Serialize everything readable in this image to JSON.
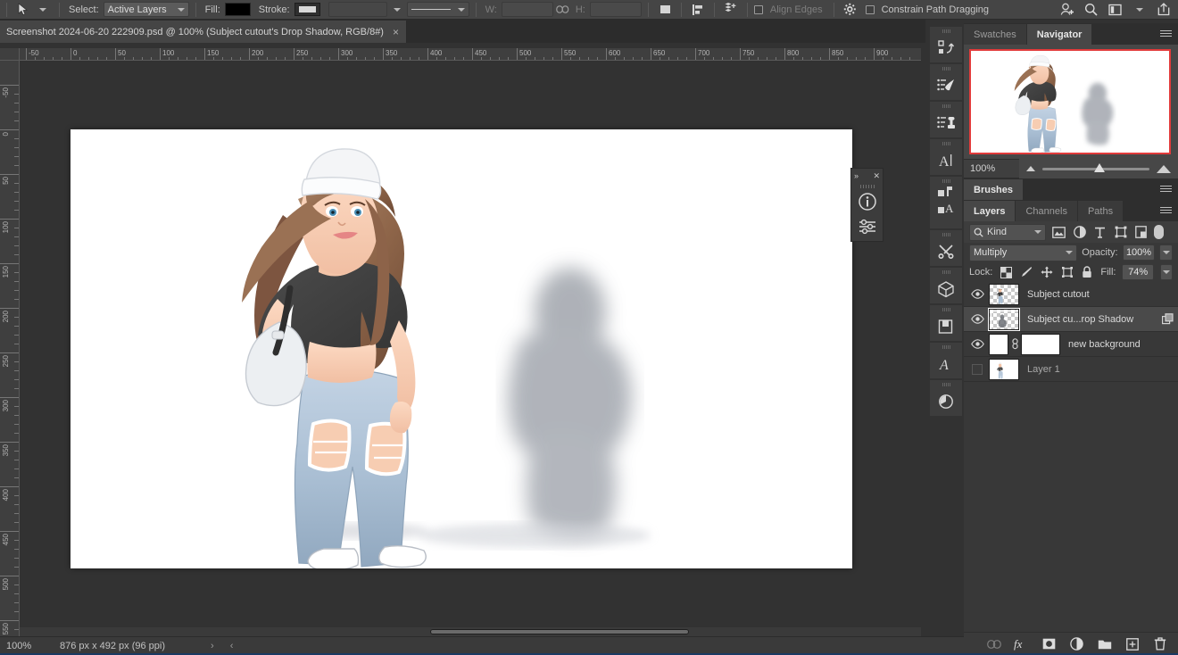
{
  "options_bar": {
    "tool_icon": "move-tool-icon",
    "select_label": "Select:",
    "select_value": "Active Layers",
    "fill_label": "Fill:",
    "fill_color": "#000000",
    "stroke_label": "Stroke:",
    "stroke_preview": "#d8d8d8",
    "width_label": "W:",
    "width_value": "",
    "link_icon": "link-icon",
    "height_label": "H:",
    "height_value": "",
    "align_edges_label": "Align Edges",
    "align_edges_checked": false,
    "constrain_label": "Constrain Path Dragging",
    "constrain_checked": false,
    "right_icons": [
      "user-add-icon",
      "search-icon",
      "workspace-icon",
      "chevron-down-icon",
      "share-icon"
    ]
  },
  "document": {
    "tab_title": "Screenshot 2024-06-20 222909.psd @ 100% (Subject cutout's Drop Shadow, RGB/8#)",
    "close_glyph": "×"
  },
  "rulers": {
    "horizontal_ticks": [
      "-50",
      "0",
      "50",
      "100",
      "150",
      "200",
      "250",
      "300",
      "350",
      "400",
      "450",
      "500",
      "550",
      "600",
      "650",
      "700",
      "750",
      "800",
      "850",
      "900"
    ],
    "vertical_ticks": [
      "-50",
      "0",
      "50",
      "100",
      "150",
      "200",
      "250",
      "300",
      "350",
      "400",
      "450",
      "500",
      "550"
    ],
    "unit": "px"
  },
  "float_panel": {
    "expand_glyph": "»",
    "close_glyph": "✕",
    "buttons": [
      "info-icon",
      "adjustments-sliders-icon"
    ]
  },
  "tool_rail": [
    {
      "name": "actions-icon"
    },
    {
      "name": "brush-presets-icon"
    },
    {
      "name": "tool-presets-icon"
    },
    {
      "name": "character-icon"
    },
    {
      "name": "layer-comps-icon"
    },
    {
      "name": "paragraph-styles-icon"
    },
    {
      "name": "timeline-tools-icon"
    },
    {
      "name": "3d-icon"
    },
    {
      "name": "libraries-icon"
    },
    {
      "name": "glyphs-icon"
    },
    {
      "name": "history-icon"
    }
  ],
  "navigator": {
    "tabs": [
      {
        "label": "Swatches",
        "active": false
      },
      {
        "label": "Navigator",
        "active": true
      }
    ],
    "zoom_value": "100%",
    "view_box_color": "#e23b3b"
  },
  "brushes": {
    "tabs": [
      {
        "label": "Brushes",
        "active": true
      }
    ]
  },
  "layers_panel": {
    "tabs": [
      {
        "label": "Layers",
        "active": true
      },
      {
        "label": "Channels",
        "active": false
      },
      {
        "label": "Paths",
        "active": false
      }
    ],
    "filter": {
      "kind_label": "Kind",
      "search_icon": "search-icon",
      "filter_icons": [
        "pixel-layer-filter-icon",
        "adjustment-layer-filter-icon",
        "type-layer-filter-icon",
        "shape-layer-filter-icon",
        "smart-object-filter-icon"
      ],
      "toggle_icon": "filter-toggle-icon"
    },
    "blend_mode": "Multiply",
    "opacity_label": "Opacity:",
    "opacity_value": "100%",
    "lock_label": "Lock:",
    "lock_icons": [
      "lock-transparency-icon",
      "lock-image-icon",
      "lock-position-icon",
      "lock-artboard-icon",
      "lock-all-icon"
    ],
    "fill_label": "Fill:",
    "fill_value": "74%",
    "rows": [
      {
        "name": "Subject cutout",
        "visible": true,
        "selected": false,
        "thumb": "transparent-subject",
        "has_mask": false,
        "badge": null
      },
      {
        "name": "Subject cu...rop Shadow",
        "visible": true,
        "selected": true,
        "thumb": "transparent-shadow",
        "has_mask": false,
        "badge": "smart-filter-icon"
      },
      {
        "name": "new background",
        "visible": true,
        "selected": false,
        "thumb": "white-fill",
        "has_mask": true,
        "badge": null
      },
      {
        "name": "Layer 1",
        "visible": false,
        "selected": false,
        "thumb": "subject-photo",
        "has_mask": false,
        "badge": null
      }
    ],
    "footer_icons": [
      "link-layers-icon",
      "layer-style-fx-icon",
      "add-mask-icon",
      "adjustment-layer-icon",
      "new-group-icon",
      "new-layer-icon",
      "delete-layer-icon"
    ]
  },
  "status_bar": {
    "zoom": "100%",
    "doc_size": "876 px x 492 px (96 ppi)",
    "next_arrow": "›",
    "prev_arrow": "‹"
  }
}
